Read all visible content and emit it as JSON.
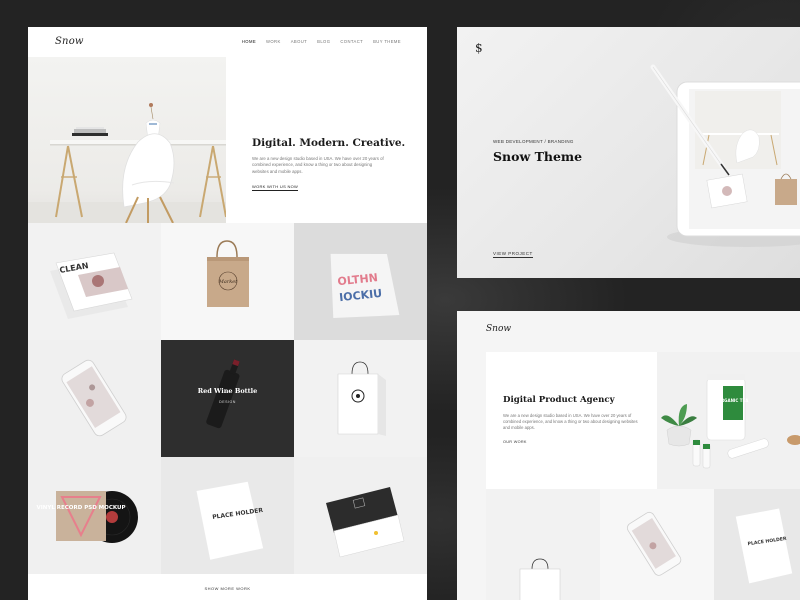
{
  "left_page": {
    "logo": "Snow",
    "nav": [
      "HOME",
      "WORK",
      "ABOUT",
      "BLOG",
      "CONTACT",
      "BUY THEME"
    ],
    "hero": {
      "title": "Digital. Modern. Creative.",
      "body": "We are a new design studio based in USA. We have over 20 years of combined experience, and know a thing or two about designing websites and mobile apps.",
      "cta": "WORK WITH US NOW"
    },
    "portfolio_caption": {
      "title": "Red Wine Bottle",
      "subtitle": "DESIGN"
    },
    "product_texts": {
      "magazine": "CLEAN",
      "tote_bag": "Market",
      "tshirt": "PLACE HOLDER",
      "vinyl": "VINYL RECORD PSD MOCKUP"
    },
    "show_more": "SHOW MORE WORK"
  },
  "top_right_page": {
    "logo": "$",
    "tags": "WEB DEVELOPMENT  /  BRANDING",
    "title": "Snow Theme",
    "cta": "VIEW PROJECT"
  },
  "bottom_right_page": {
    "logo": "Snow",
    "card": {
      "title": "Digital Product Agency",
      "body": "We are a new design studio based in USA. We have over 20 years of combined experience, and know a thing or two about designing websites and mobile apps.",
      "cta": "OUR WORK"
    },
    "product_texts": {
      "jar": "ORGANIC TEA",
      "tshirt": "PLACE HOLDER"
    }
  },
  "colors": {
    "background": "#242424",
    "page": "#ffffff",
    "dark_tile": "#2e2e2e",
    "accent_green": "#2e8b3d"
  }
}
